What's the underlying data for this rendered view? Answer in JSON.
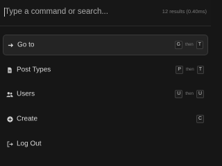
{
  "search": {
    "placeholder": "Type a command or search...",
    "results_meta": "12 results (0.40ms)"
  },
  "commands": [
    {
      "label": "Go to",
      "icon": "arrow-right-icon",
      "active": true,
      "keys": [
        "G",
        "T"
      ],
      "then_label": "then"
    },
    {
      "label": "Post Types",
      "icon": "document-icon",
      "active": false,
      "keys": [
        "P",
        "T"
      ],
      "then_label": "then"
    },
    {
      "label": "Users",
      "icon": "users-icon",
      "active": false,
      "keys": [
        "U",
        "U"
      ],
      "then_label": "then"
    },
    {
      "label": "Create",
      "icon": "plus-circle-icon",
      "active": false,
      "keys": [
        "C"
      ]
    },
    {
      "label": "Log Out",
      "icon": "logout-icon",
      "active": false,
      "keys": []
    }
  ]
}
